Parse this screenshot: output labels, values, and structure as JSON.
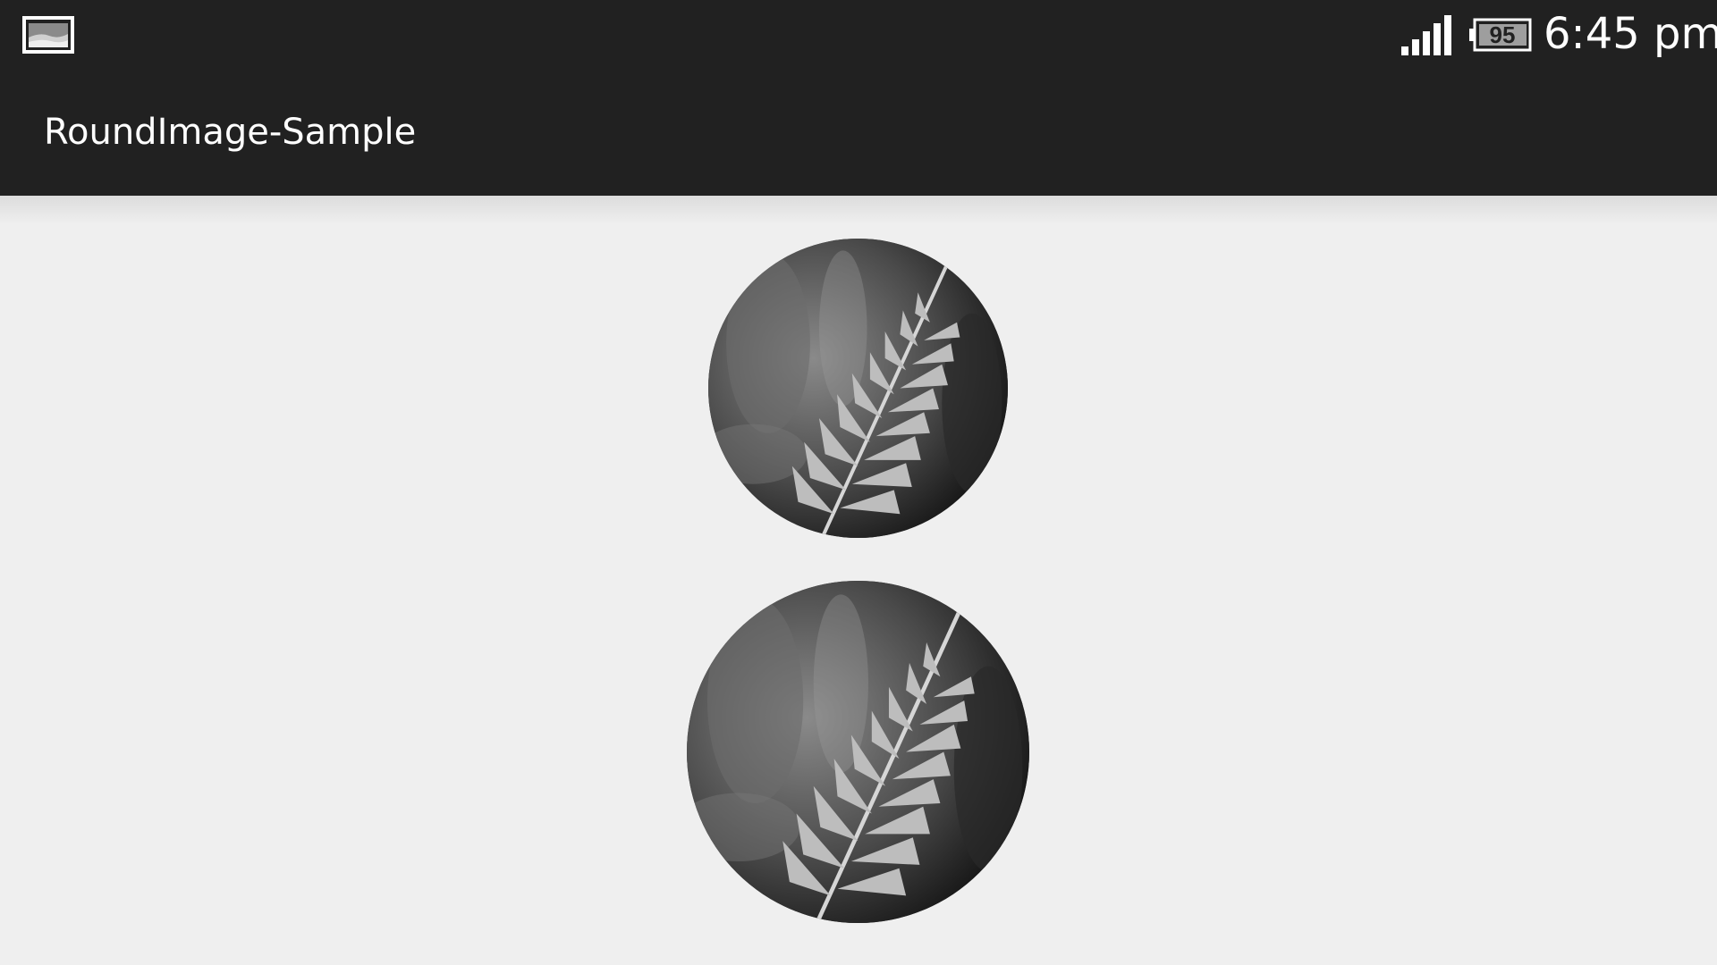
{
  "status_bar": {
    "notification_icon": "image-icon",
    "signal_icon": "signal-icon",
    "battery_icon": "battery-icon",
    "battery_level": "95",
    "time": "6:45 pm"
  },
  "action_bar": {
    "title": "RoundImage-Sample"
  },
  "content": {
    "images": [
      {
        "name": "round-image-small",
        "subject": "fern-photo"
      },
      {
        "name": "round-image-large",
        "subject": "fern-photo"
      }
    ]
  },
  "colors": {
    "bar_background": "#212121",
    "page_background": "#efefef"
  }
}
